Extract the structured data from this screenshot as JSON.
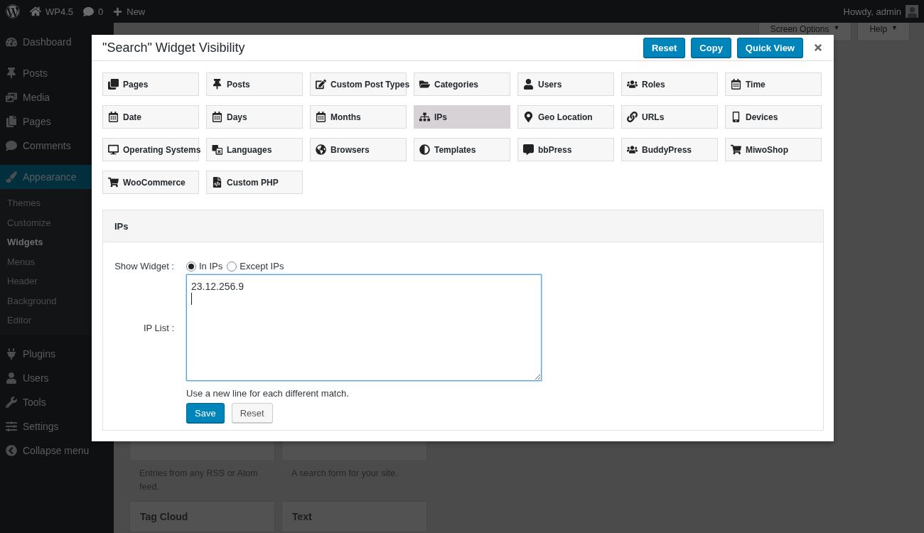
{
  "admin_bar": {
    "site": "WP4.5",
    "comments": "0",
    "new": "New",
    "greeting": "Howdy, admin"
  },
  "sidebar": {
    "items": [
      {
        "label": "Dashboard",
        "selected": false
      },
      {
        "label": "Posts",
        "selected": false
      },
      {
        "label": "Media",
        "selected": false
      },
      {
        "label": "Pages",
        "selected": false
      },
      {
        "label": "Comments",
        "selected": false
      },
      {
        "label": "Appearance",
        "selected": true,
        "children": [
          {
            "label": "Themes",
            "selected": false
          },
          {
            "label": "Customize",
            "selected": false
          },
          {
            "label": "Widgets",
            "selected": true
          },
          {
            "label": "Menus",
            "selected": false
          },
          {
            "label": "Header",
            "selected": false
          },
          {
            "label": "Background",
            "selected": false
          },
          {
            "label": "Editor",
            "selected": false
          }
        ]
      },
      {
        "label": "Plugins",
        "selected": false
      },
      {
        "label": "Users",
        "selected": false
      },
      {
        "label": "Tools",
        "selected": false
      },
      {
        "label": "Settings",
        "selected": false
      },
      {
        "label": "Collapse menu",
        "selected": false
      }
    ]
  },
  "screen_tabs": [
    {
      "label": "Screen Options",
      "caret": "▼"
    },
    {
      "label": "Help",
      "caret": "▼"
    }
  ],
  "widgets": [
    {
      "description": "Entries from any RSS or Atom feed."
    },
    {
      "description": "A search form for your site."
    },
    {
      "title": "Tag Cloud"
    },
    {
      "title": "Text"
    }
  ],
  "modal": {
    "title": "\"Search\" Widget Visibility",
    "buttons": [
      "Reset",
      "Copy",
      "Quick View"
    ],
    "conditions": [
      {
        "label": "Pages",
        "selected": false
      },
      {
        "label": "Posts",
        "selected": false
      },
      {
        "label": "Custom Post Types",
        "selected": false
      },
      {
        "label": "Categories",
        "selected": false
      },
      {
        "label": "Users",
        "selected": false
      },
      {
        "label": "Roles",
        "selected": false
      },
      {
        "label": "Time",
        "selected": false
      },
      {
        "label": "Date",
        "selected": false
      },
      {
        "label": "Days",
        "selected": false
      },
      {
        "label": "Months",
        "selected": false
      },
      {
        "label": "IPs",
        "selected": true
      },
      {
        "label": "Geo Location",
        "selected": false
      },
      {
        "label": "URLs",
        "selected": false
      },
      {
        "label": "Devices",
        "selected": false
      },
      {
        "label": "Operating Systems",
        "selected": false
      },
      {
        "label": "Languages",
        "selected": false
      },
      {
        "label": "Browsers",
        "selected": false
      },
      {
        "label": "Templates",
        "selected": false
      },
      {
        "label": "bbPress",
        "selected": false
      },
      {
        "label": "BuddyPress",
        "selected": false
      },
      {
        "label": "MiwoShop",
        "selected": false
      },
      {
        "label": "WooCommerce",
        "selected": false
      },
      {
        "label": "Custom PHP",
        "selected": false
      }
    ],
    "panel": {
      "title": "IPs",
      "show_label": "Show Widget :",
      "options": [
        {
          "label": "In IPs",
          "selected": true
        },
        {
          "label": "Except IPs",
          "selected": false
        }
      ],
      "list_label": "IP List :",
      "value": "23.12.256.9\n",
      "hint": "Use a new line for each different match.",
      "save": "Save",
      "reset": "Reset"
    }
  }
}
